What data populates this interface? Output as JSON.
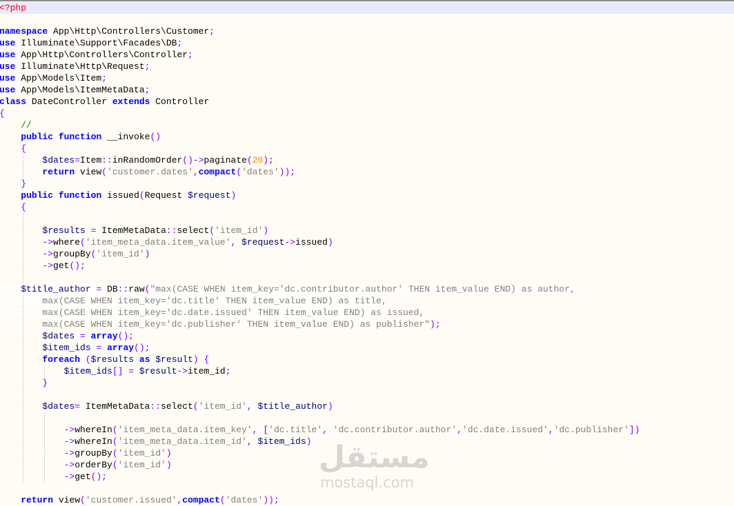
{
  "editor": {
    "colors": {
      "keyword": "#0000ff",
      "variable": "#000080",
      "operator": "#8000ff",
      "string": "#808080",
      "number": "#ff8000",
      "comment": "#008000",
      "php_tag": "#ff0000",
      "current_line": "#e8e8ff"
    },
    "lines": [
      {
        "current": true,
        "tokens": [
          [
            "t",
            "<?php"
          ]
        ]
      },
      {
        "tokens": []
      },
      {
        "tokens": [
          [
            "k",
            "namespace"
          ],
          [
            "p",
            " App\\Http\\Controllers\\Customer"
          ],
          [
            "o",
            ";"
          ]
        ]
      },
      {
        "tokens": [
          [
            "k",
            "use"
          ],
          [
            "p",
            " Illuminate\\Support\\Facades\\DB"
          ],
          [
            "o",
            ";"
          ]
        ]
      },
      {
        "tokens": [
          [
            "k",
            "use"
          ],
          [
            "p",
            " App\\Http\\Controllers\\Controller"
          ],
          [
            "o",
            ";"
          ]
        ]
      },
      {
        "tokens": [
          [
            "k",
            "use"
          ],
          [
            "p",
            " Illuminate\\Http\\Request"
          ],
          [
            "o",
            ";"
          ]
        ]
      },
      {
        "tokens": [
          [
            "k",
            "use"
          ],
          [
            "p",
            " App\\Models\\Item"
          ],
          [
            "o",
            ";"
          ]
        ]
      },
      {
        "tokens": [
          [
            "k",
            "use"
          ],
          [
            "p",
            " App\\Models\\ItemMetaData"
          ],
          [
            "o",
            ";"
          ]
        ]
      },
      {
        "tokens": [
          [
            "k",
            "class"
          ],
          [
            "p",
            " DateController "
          ],
          [
            "k",
            "extends"
          ],
          [
            "p",
            " Controller"
          ]
        ]
      },
      {
        "tokens": [
          [
            "o",
            "{"
          ]
        ]
      },
      {
        "tokens": [
          [
            "p",
            "    "
          ],
          [
            "c",
            "//"
          ]
        ]
      },
      {
        "tokens": [
          [
            "p",
            "    "
          ],
          [
            "k",
            "public"
          ],
          [
            "p",
            " "
          ],
          [
            "k",
            "function"
          ],
          [
            "p",
            " __invoke"
          ],
          [
            "o",
            "()"
          ]
        ]
      },
      {
        "tokens": [
          [
            "p",
            "    "
          ],
          [
            "o",
            "{"
          ]
        ]
      },
      {
        "guides": [
          1
        ],
        "tokens": [
          [
            "p",
            "        "
          ],
          [
            "v",
            "$dates"
          ],
          [
            "o",
            "="
          ],
          [
            "p",
            "Item"
          ],
          [
            "o",
            "::"
          ],
          [
            "p",
            "inRandomOrder"
          ],
          [
            "o",
            "()->"
          ],
          [
            "p",
            "paginate"
          ],
          [
            "o",
            "("
          ],
          [
            "n",
            "20"
          ],
          [
            "o",
            ");"
          ]
        ]
      },
      {
        "guides": [
          1
        ],
        "tokens": [
          [
            "p",
            "        "
          ],
          [
            "k",
            "return"
          ],
          [
            "p",
            " view"
          ],
          [
            "o",
            "("
          ],
          [
            "s",
            "'customer.dates'"
          ],
          [
            "o",
            ","
          ],
          [
            "k",
            "compact"
          ],
          [
            "o",
            "("
          ],
          [
            "s",
            "'dates'"
          ],
          [
            "o",
            "));"
          ]
        ]
      },
      {
        "tokens": [
          [
            "p",
            "    "
          ],
          [
            "o",
            "}"
          ]
        ]
      },
      {
        "tokens": [
          [
            "p",
            "    "
          ],
          [
            "k",
            "public"
          ],
          [
            "p",
            " "
          ],
          [
            "k",
            "function"
          ],
          [
            "p",
            " issued"
          ],
          [
            "o",
            "("
          ],
          [
            "p",
            "Request "
          ],
          [
            "v",
            "$request"
          ],
          [
            "o",
            ")"
          ]
        ]
      },
      {
        "tokens": [
          [
            "p",
            "    "
          ],
          [
            "o",
            "{"
          ]
        ]
      },
      {
        "guides": [
          1
        ],
        "tokens": []
      },
      {
        "guides": [
          1
        ],
        "tokens": [
          [
            "p",
            "        "
          ],
          [
            "v",
            "$results"
          ],
          [
            "p",
            " "
          ],
          [
            "o",
            "="
          ],
          [
            "p",
            " ItemMetaData"
          ],
          [
            "o",
            "::"
          ],
          [
            "p",
            "select"
          ],
          [
            "o",
            "("
          ],
          [
            "s",
            "'item_id'"
          ],
          [
            "o",
            ")"
          ]
        ]
      },
      {
        "guides": [
          1
        ],
        "tokens": [
          [
            "p",
            "        "
          ],
          [
            "o",
            "->"
          ],
          [
            "p",
            "where"
          ],
          [
            "o",
            "("
          ],
          [
            "s",
            "'item_meta_data.item_value'"
          ],
          [
            "o",
            ","
          ],
          [
            "p",
            " "
          ],
          [
            "v",
            "$request"
          ],
          [
            "o",
            "->"
          ],
          [
            "p",
            "issued"
          ],
          [
            "o",
            ")"
          ]
        ]
      },
      {
        "guides": [
          1
        ],
        "tokens": [
          [
            "p",
            "        "
          ],
          [
            "o",
            "->"
          ],
          [
            "p",
            "groupBy"
          ],
          [
            "o",
            "("
          ],
          [
            "s",
            "'item_id'"
          ],
          [
            "o",
            ")"
          ]
        ]
      },
      {
        "guides": [
          1
        ],
        "tokens": [
          [
            "p",
            "        "
          ],
          [
            "o",
            "->"
          ],
          [
            "p",
            "get"
          ],
          [
            "o",
            "();"
          ]
        ]
      },
      {
        "guides": [
          1
        ],
        "tokens": []
      },
      {
        "ws": true,
        "tokens": [
          [
            "p",
            "    "
          ],
          [
            "v",
            "$title_author"
          ],
          [
            "p",
            " "
          ],
          [
            "o",
            "="
          ],
          [
            "p",
            " DB"
          ],
          [
            "o",
            "::"
          ],
          [
            "p",
            "raw"
          ],
          [
            "o",
            "("
          ],
          [
            "s",
            "\"max(CASE WHEN item_key='dc.contributor.author' THEN item_value END) as author,"
          ]
        ]
      },
      {
        "ws": true,
        "guides": [
          1
        ],
        "tokens": [
          [
            "p",
            "        "
          ],
          [
            "s",
            "max(CASE WHEN item_key='dc.title' THEN item_value END) as title,"
          ]
        ]
      },
      {
        "ws": true,
        "guides": [
          1
        ],
        "tokens": [
          [
            "p",
            "        "
          ],
          [
            "s",
            "max(CASE WHEN item_key='dc.date.issued' THEN item_value END) as issued,"
          ]
        ]
      },
      {
        "guides": [
          1
        ],
        "tokens": [
          [
            "p",
            "        "
          ],
          [
            "s",
            "max(CASE WHEN item_key='dc.publisher' THEN item_value END) as publisher\""
          ],
          [
            "o",
            ");"
          ]
        ]
      },
      {
        "guides": [
          1
        ],
        "tokens": [
          [
            "p",
            "        "
          ],
          [
            "v",
            "$dates"
          ],
          [
            "p",
            " "
          ],
          [
            "o",
            "="
          ],
          [
            "p",
            " "
          ],
          [
            "k",
            "array"
          ],
          [
            "o",
            "();"
          ]
        ]
      },
      {
        "guides": [
          1
        ],
        "tokens": [
          [
            "p",
            "        "
          ],
          [
            "v",
            "$item_ids"
          ],
          [
            "p",
            " "
          ],
          [
            "o",
            "="
          ],
          [
            "p",
            " "
          ],
          [
            "k",
            "array"
          ],
          [
            "o",
            "();"
          ]
        ]
      },
      {
        "guides": [
          1
        ],
        "tokens": [
          [
            "p",
            "        "
          ],
          [
            "k",
            "foreach"
          ],
          [
            "p",
            " "
          ],
          [
            "o",
            "("
          ],
          [
            "v",
            "$results"
          ],
          [
            "p",
            " "
          ],
          [
            "k",
            "as"
          ],
          [
            "p",
            " "
          ],
          [
            "v",
            "$result"
          ],
          [
            "o",
            ")"
          ],
          [
            "p",
            " "
          ],
          [
            "o",
            "{"
          ]
        ]
      },
      {
        "guides": [
          1,
          2
        ],
        "tokens": [
          [
            "p",
            "            "
          ],
          [
            "v",
            "$item_ids"
          ],
          [
            "o",
            "[]"
          ],
          [
            "p",
            " "
          ],
          [
            "o",
            "="
          ],
          [
            "p",
            " "
          ],
          [
            "v",
            "$result"
          ],
          [
            "o",
            "->"
          ],
          [
            "p",
            "item_id"
          ],
          [
            "o",
            ";"
          ]
        ]
      },
      {
        "guides": [
          1
        ],
        "tokens": [
          [
            "p",
            "        "
          ],
          [
            "o",
            "}"
          ]
        ]
      },
      {
        "guides": [
          1
        ],
        "tokens": []
      },
      {
        "guides": [
          1
        ],
        "tokens": [
          [
            "p",
            "        "
          ],
          [
            "v",
            "$dates"
          ],
          [
            "o",
            "="
          ],
          [
            "p",
            " ItemMetaData"
          ],
          [
            "o",
            "::"
          ],
          [
            "p",
            "select"
          ],
          [
            "o",
            "("
          ],
          [
            "s",
            "'item_id'"
          ],
          [
            "o",
            ","
          ],
          [
            "p",
            " "
          ],
          [
            "v",
            "$title_author"
          ],
          [
            "o",
            ")"
          ]
        ]
      },
      {
        "guides": [
          1,
          2
        ],
        "tokens": []
      },
      {
        "guides": [
          1,
          2
        ],
        "tokens": [
          [
            "p",
            "            "
          ],
          [
            "o",
            "->"
          ],
          [
            "p",
            "whereIn"
          ],
          [
            "o",
            "("
          ],
          [
            "s",
            "'item_meta_data.item_key'"
          ],
          [
            "o",
            ","
          ],
          [
            "p",
            " "
          ],
          [
            "o",
            "["
          ],
          [
            "s",
            "'dc.title'"
          ],
          [
            "o",
            ","
          ],
          [
            "p",
            " "
          ],
          [
            "s",
            "'dc.contributor.author'"
          ],
          [
            "o",
            ","
          ],
          [
            "s",
            "'dc.date.issued'"
          ],
          [
            "o",
            ","
          ],
          [
            "s",
            "'dc.publisher'"
          ],
          [
            "o",
            "])"
          ]
        ]
      },
      {
        "guides": [
          1,
          2
        ],
        "tokens": [
          [
            "p",
            "            "
          ],
          [
            "o",
            "->"
          ],
          [
            "p",
            "whereIn"
          ],
          [
            "o",
            "("
          ],
          [
            "s",
            "'item_meta_data.item_id'"
          ],
          [
            "o",
            ","
          ],
          [
            "p",
            " "
          ],
          [
            "v",
            "$item_ids"
          ],
          [
            "o",
            ")"
          ]
        ]
      },
      {
        "guides": [
          1,
          2
        ],
        "tokens": [
          [
            "p",
            "            "
          ],
          [
            "o",
            "->"
          ],
          [
            "p",
            "groupBy"
          ],
          [
            "o",
            "("
          ],
          [
            "s",
            "'item_id'"
          ],
          [
            "o",
            ")"
          ]
        ]
      },
      {
        "guides": [
          1,
          2
        ],
        "tokens": [
          [
            "p",
            "            "
          ],
          [
            "o",
            "->"
          ],
          [
            "p",
            "orderBy"
          ],
          [
            "o",
            "("
          ],
          [
            "s",
            "'item_id'"
          ],
          [
            "o",
            ")"
          ]
        ]
      },
      {
        "guides": [
          1,
          2
        ],
        "tokens": [
          [
            "p",
            "            "
          ],
          [
            "o",
            "->"
          ],
          [
            "p",
            "get"
          ],
          [
            "o",
            "();"
          ]
        ]
      },
      {
        "tokens": []
      },
      {
        "tokens": [
          [
            "p",
            "    "
          ],
          [
            "k",
            "return"
          ],
          [
            "p",
            " view"
          ],
          [
            "o",
            "("
          ],
          [
            "s",
            "'customer.issued'"
          ],
          [
            "o",
            ","
          ],
          [
            "k",
            "compact"
          ],
          [
            "o",
            "("
          ],
          [
            "s",
            "'dates'"
          ],
          [
            "o",
            "));"
          ]
        ]
      }
    ]
  },
  "watermark": {
    "arabic": "مستقل",
    "latin": "mostaql.com"
  }
}
